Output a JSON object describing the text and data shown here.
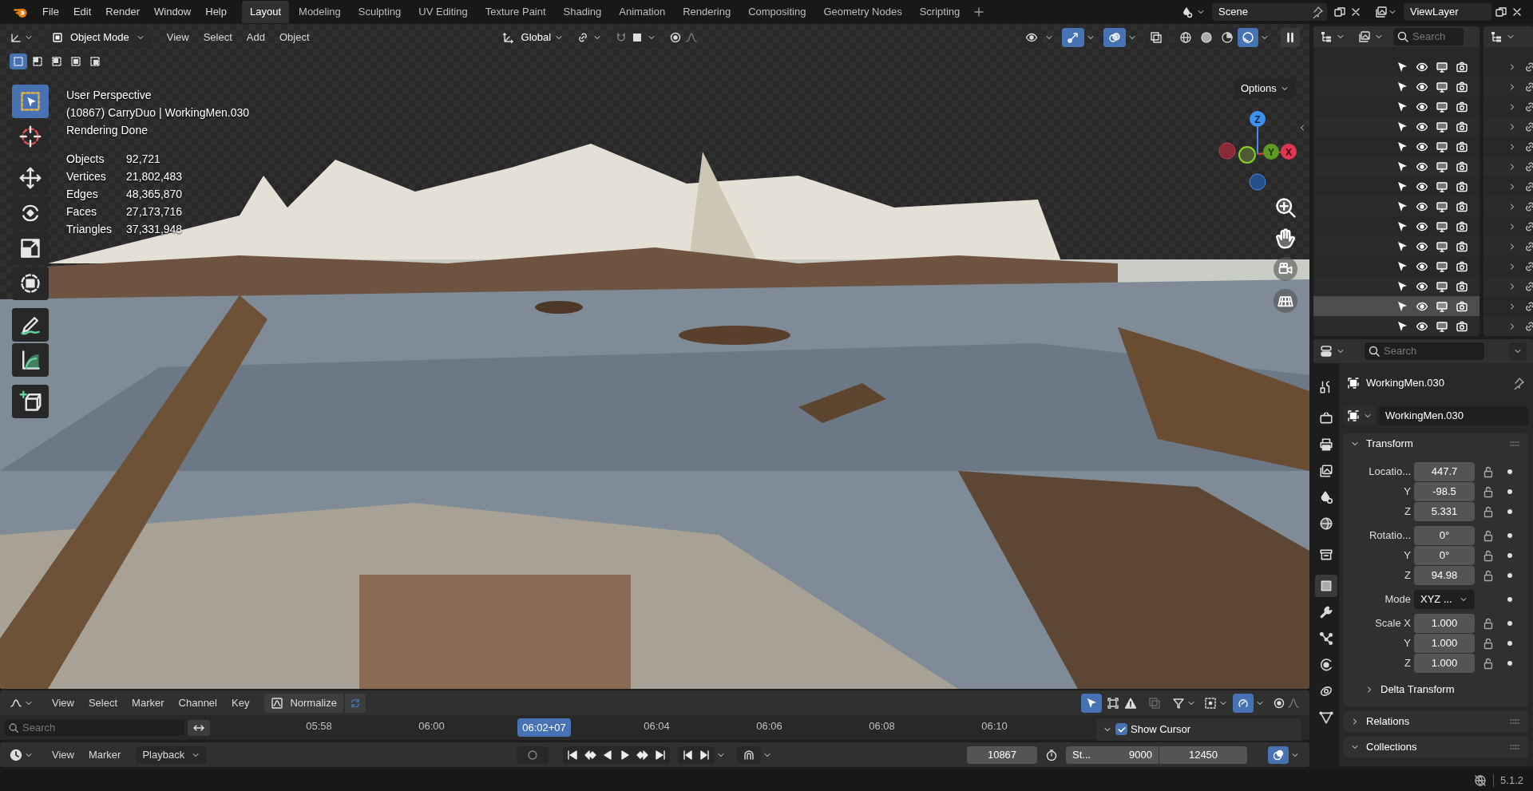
{
  "top_menu": [
    "File",
    "Edit",
    "Render",
    "Window",
    "Help"
  ],
  "workspaces": [
    {
      "label": "Layout",
      "selected": true
    },
    {
      "label": "Modeling",
      "selected": false
    },
    {
      "label": "Sculpting",
      "selected": false
    },
    {
      "label": "UV Editing",
      "selected": false
    },
    {
      "label": "Texture Paint",
      "selected": false
    },
    {
      "label": "Shading",
      "selected": false
    },
    {
      "label": "Animation",
      "selected": false
    },
    {
      "label": "Rendering",
      "selected": false
    },
    {
      "label": "Compositing",
      "selected": false
    },
    {
      "label": "Geometry Nodes",
      "selected": false
    },
    {
      "label": "Scripting",
      "selected": false
    }
  ],
  "scene": "Scene",
  "view_layer": "ViewLayer",
  "viewport": {
    "mode": "Object Mode",
    "menus": [
      "View",
      "Select",
      "Add",
      "Object"
    ],
    "orientation": "Global",
    "toggles": [
      {
        "kind": "visibility",
        "on": false
      },
      {
        "kind": "gizmo",
        "on": true
      },
      {
        "kind": "overlay",
        "on": true
      },
      {
        "kind": "xray",
        "on": false
      }
    ],
    "shading": [
      {
        "kind": "wireframe",
        "selected": false
      },
      {
        "kind": "solid",
        "selected": false
      },
      {
        "kind": "material",
        "selected": false
      },
      {
        "kind": "rendered",
        "selected": true
      }
    ],
    "select_modes": [
      {
        "selected": true
      },
      {
        "selected": false
      },
      {
        "selected": false
      },
      {
        "selected": false
      },
      {
        "selected": false
      }
    ],
    "tools": [
      {
        "kind": "select",
        "selected": true
      },
      {
        "kind": "cursor",
        "selected": false
      },
      {
        "kind": "move",
        "selected": false
      },
      {
        "kind": "rotate",
        "selected": false
      },
      {
        "kind": "scale",
        "selected": false
      },
      {
        "kind": "transform",
        "selected": false
      },
      {
        "kind": "annotate",
        "selected": false
      },
      {
        "kind": "measure",
        "selected": false
      },
      {
        "kind": "add_cube",
        "selected": false
      }
    ],
    "options": "Options",
    "info": [
      "User Perspective",
      "(10867) CarryDuo | WorkingMen.030",
      "Rendering Done"
    ],
    "stats": [
      {
        "label": "Objects",
        "value": "92,721"
      },
      {
        "label": "Vertices",
        "value": "21,802,483"
      },
      {
        "label": "Edges",
        "value": "48,365,870"
      },
      {
        "label": "Faces",
        "value": "27,173,716"
      },
      {
        "label": "Triangles",
        "value": "37,331,948"
      }
    ],
    "axis_labels": [
      "Z",
      "Y",
      "X"
    ]
  },
  "outliner": {
    "search_placeholder": "Search",
    "rows": [
      {
        "selected": false
      },
      {
        "selected": false
      },
      {
        "selected": false
      },
      {
        "selected": false
      },
      {
        "selected": false
      },
      {
        "selected": false
      },
      {
        "selected": false
      },
      {
        "selected": false
      },
      {
        "selected": false
      },
      {
        "selected": false
      },
      {
        "selected": false
      },
      {
        "selected": false
      },
      {
        "selected": true
      },
      {
        "selected": false
      }
    ]
  },
  "properties": {
    "search_placeholder": "Search",
    "tabs": [
      {
        "kind": "tool",
        "selected": false
      },
      {
        "kind": "render",
        "selected": false
      },
      {
        "kind": "output",
        "selected": false
      },
      {
        "kind": "view_layer",
        "selected": false
      },
      {
        "kind": "scene",
        "selected": false
      },
      {
        "kind": "world",
        "selected": false
      },
      {
        "kind": "collection",
        "selected": false
      },
      {
        "kind": "object",
        "selected": true
      },
      {
        "kind": "modifiers",
        "selected": false
      },
      {
        "kind": "particles",
        "selected": false
      },
      {
        "kind": "physics",
        "selected": false
      },
      {
        "kind": "constraints",
        "selected": false
      },
      {
        "kind": "data",
        "selected": false
      }
    ],
    "object_name": "WorkingMen.030",
    "data_name": "WorkingMen.030",
    "transform": {
      "title": "Transform",
      "expanded": true,
      "rows": [
        {
          "kind": "field",
          "label": "Locatio...",
          "value": "447.7"
        },
        {
          "kind": "field",
          "label": "Y",
          "value": "-98.5"
        },
        {
          "kind": "field",
          "label": "Z",
          "value": "5.331"
        },
        {
          "kind": "field",
          "label": "Rotatio...",
          "value": "0°"
        },
        {
          "kind": "field",
          "label": "Y",
          "value": "0°"
        },
        {
          "kind": "field",
          "label": "Z",
          "value": "94.98"
        },
        {
          "kind": "dropdown",
          "label": "Mode",
          "value": "XYZ ..."
        },
        {
          "kind": "field",
          "label": "Scale X",
          "value": "1.000"
        },
        {
          "kind": "field",
          "label": "Y",
          "value": "1.000"
        },
        {
          "kind": "field",
          "label": "Z",
          "value": "1.000"
        }
      ],
      "sub_panel": {
        "title": "Delta Transform",
        "expanded": false
      }
    },
    "panels": [
      {
        "title": "Relations",
        "expanded": false
      },
      {
        "title": "Collections",
        "expanded": true
      }
    ]
  },
  "timeline": {
    "menus": [
      "View",
      "Select",
      "Marker",
      "Channel",
      "Key"
    ],
    "normalize": {
      "label": "Normalize",
      "on": false
    },
    "search_placeholder": "Search",
    "ticks": [
      {
        "label": "05:58",
        "current": false
      },
      {
        "label": "06:00",
        "current": false
      },
      {
        "label": "06:02+07",
        "current": true
      },
      {
        "label": "06:04",
        "current": false
      },
      {
        "label": "06:06",
        "current": false
      },
      {
        "label": "06:08",
        "current": false
      },
      {
        "label": "06:10",
        "current": false
      }
    ],
    "show_cursor": {
      "label": "Show Cursor",
      "checked": true
    }
  },
  "playback": {
    "menus": [
      "View",
      "Marker"
    ],
    "playback": "Playback",
    "current_frame": "10867",
    "start_label": "St...",
    "start": "9000",
    "end": "12450"
  },
  "status": {
    "version": "5.1.2"
  }
}
